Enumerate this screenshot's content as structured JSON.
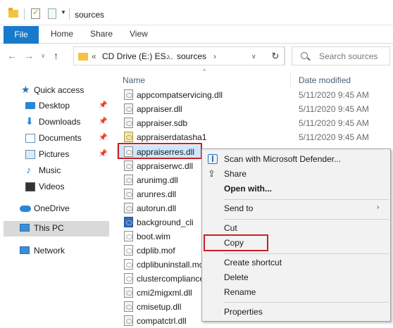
{
  "titlebar": {
    "title": "sources"
  },
  "ribbon": {
    "tabs": [
      "File",
      "Home",
      "Share",
      "View"
    ]
  },
  "address": {
    "prefix": "«",
    "part1": "CD Drive (E:) ES...",
    "sep": "›",
    "part2": "sources",
    "search_placeholder": "Search sources"
  },
  "navpane": {
    "items": [
      {
        "label": "Quick access"
      },
      {
        "label": "Desktop"
      },
      {
        "label": "Downloads"
      },
      {
        "label": "Documents"
      },
      {
        "label": "Pictures"
      },
      {
        "label": "Music"
      },
      {
        "label": "Videos"
      },
      {
        "label": "OneDrive"
      },
      {
        "label": "This PC"
      },
      {
        "label": "Network"
      }
    ]
  },
  "filelist": {
    "col_name": "Name",
    "col_date": "Date modified",
    "files": [
      {
        "name": "appcompatservicing.dll",
        "date": "5/11/2020 9:45 AM"
      },
      {
        "name": "appraiser.dll",
        "date": "5/11/2020 9:45 AM"
      },
      {
        "name": "appraiser.sdb",
        "date": "5/11/2020 9:45 AM"
      },
      {
        "name": "appraiserdatasha1",
        "date": "5/11/2020 9:45 AM"
      },
      {
        "name": "appraiserres.dll",
        "date": ""
      },
      {
        "name": "appraiserwc.dll",
        "date": ""
      },
      {
        "name": "arunimg.dll",
        "date": ""
      },
      {
        "name": "arunres.dll",
        "date": ""
      },
      {
        "name": "autorun.dll",
        "date": ""
      },
      {
        "name": "background_cli",
        "date": ""
      },
      {
        "name": "boot.wim",
        "date": ""
      },
      {
        "name": "cdplib.mof",
        "date": ""
      },
      {
        "name": "cdplibuninstall.mo",
        "date": ""
      },
      {
        "name": "clustercompliance",
        "date": ""
      },
      {
        "name": "cmi2migxml.dll",
        "date": ""
      },
      {
        "name": "cmisetup.dll",
        "date": ""
      },
      {
        "name": "compatctrl.dll",
        "date": ""
      }
    ]
  },
  "context_menu": {
    "scan": "Scan with Microsoft Defender...",
    "share": "Share",
    "open_with": "Open with...",
    "send_to": "Send to",
    "cut": "Cut",
    "copy": "Copy",
    "create_shortcut": "Create shortcut",
    "delete": "Delete",
    "rename": "Rename",
    "properties": "Properties"
  }
}
